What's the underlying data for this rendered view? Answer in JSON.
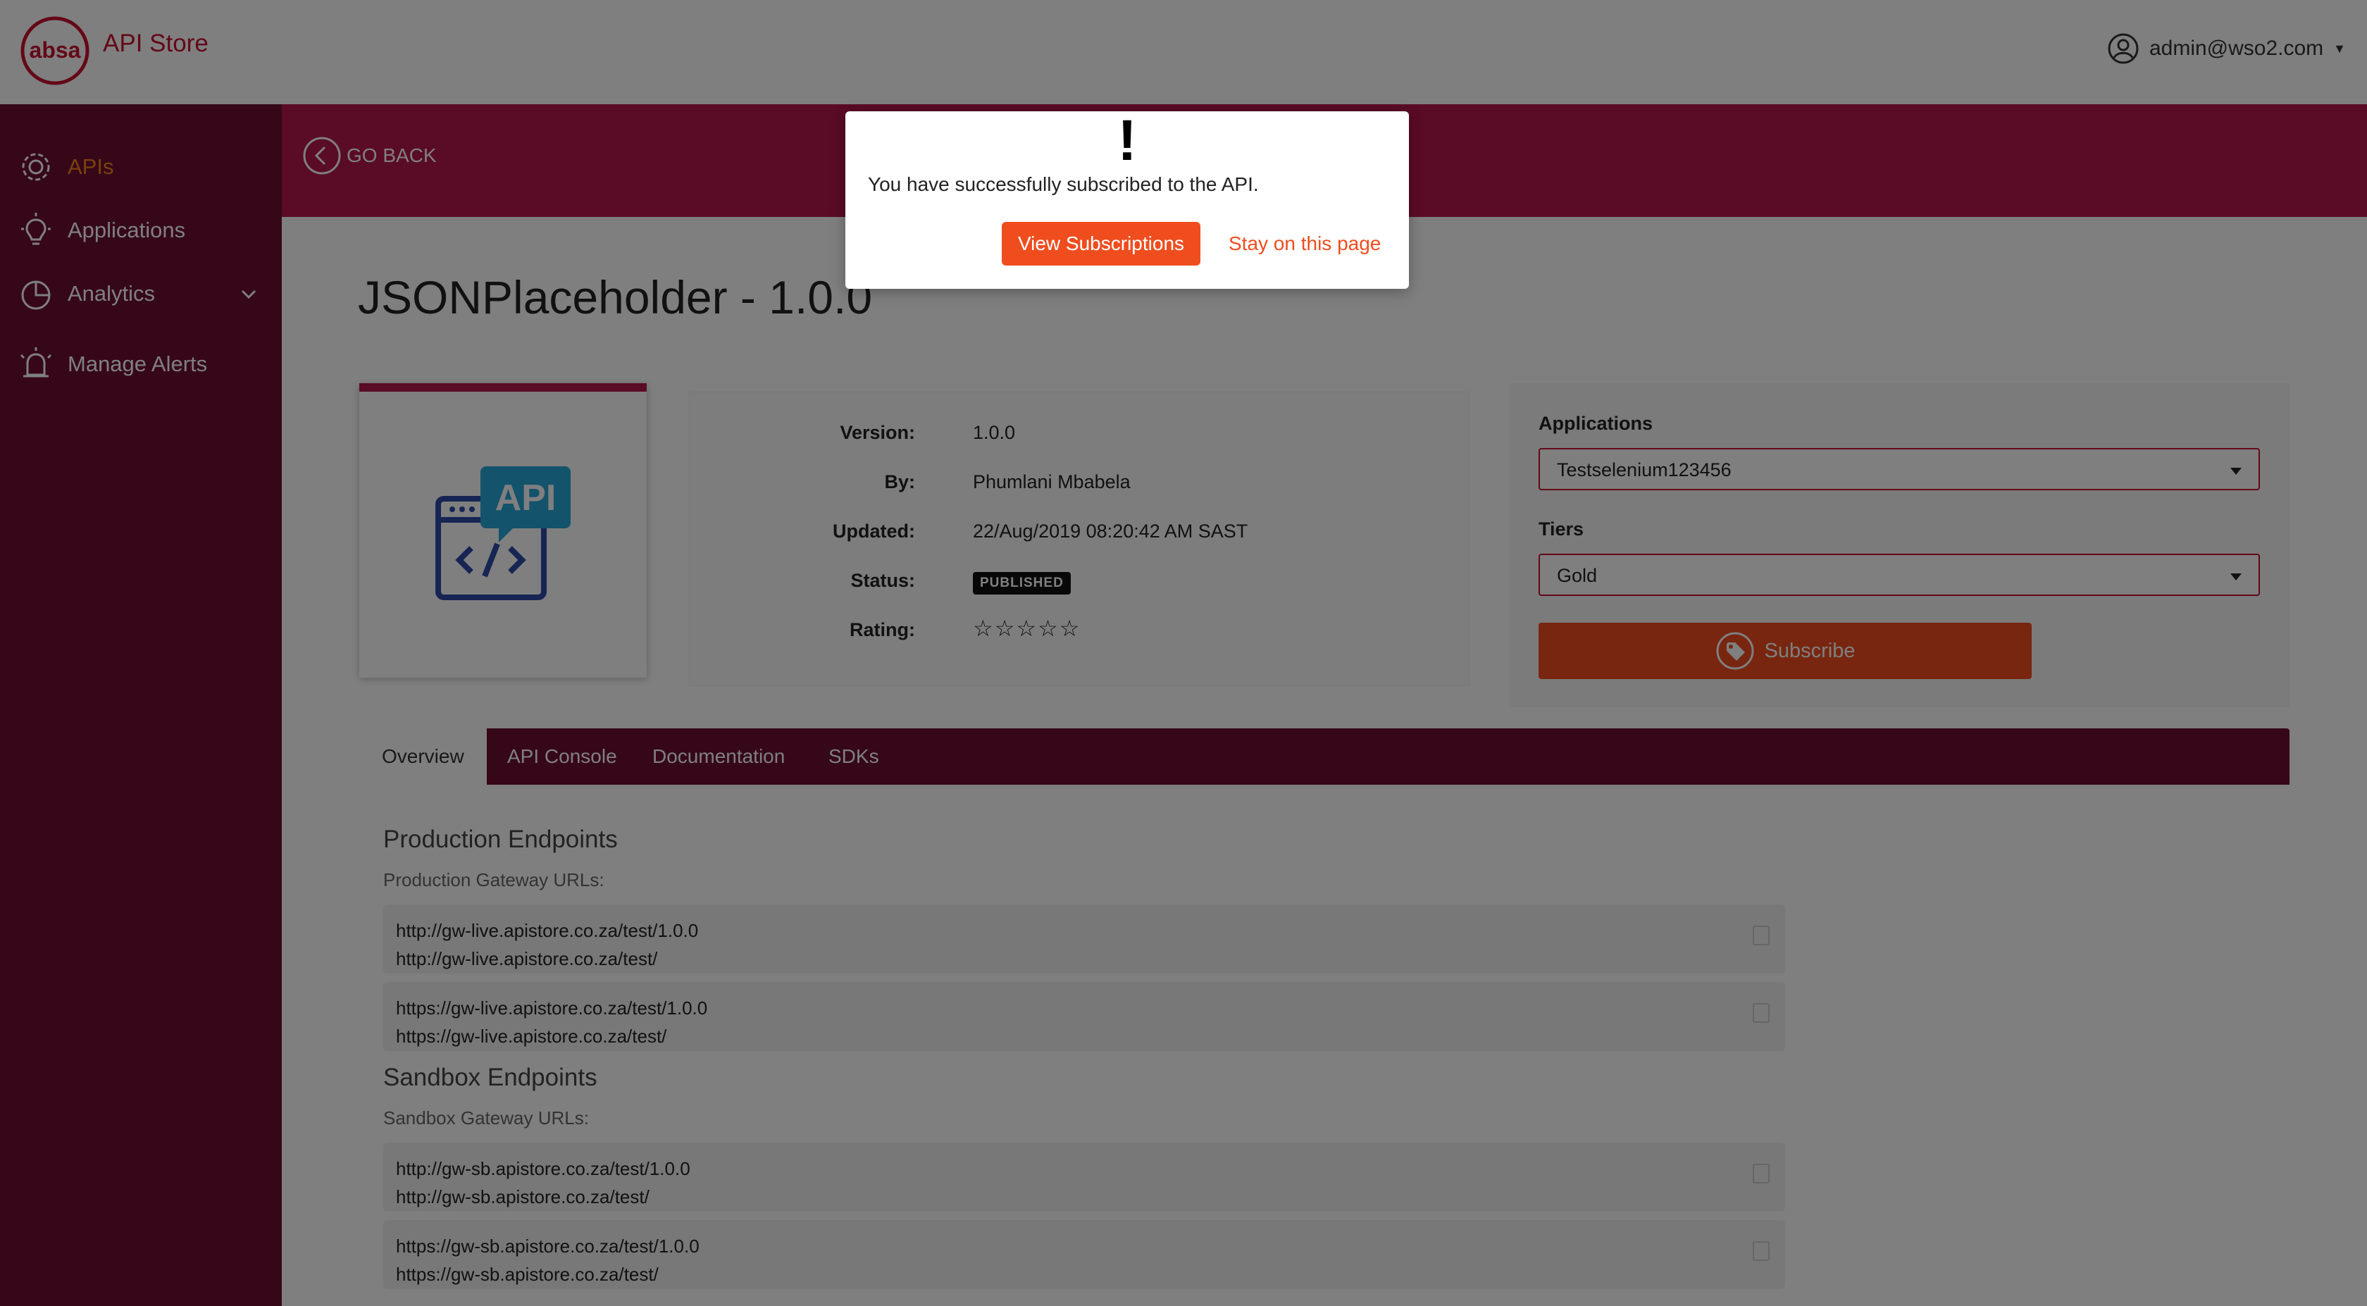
{
  "header": {
    "app_name": "API Store",
    "user": "admin@wso2.com"
  },
  "sidebar": {
    "items": [
      {
        "label": "APIs",
        "icon": "gear-icon",
        "active": true
      },
      {
        "label": "Applications",
        "icon": "lightbulb-icon"
      },
      {
        "label": "Analytics",
        "icon": "pie-chart-icon"
      },
      {
        "label": "Manage Alerts",
        "icon": "alarm-icon"
      }
    ]
  },
  "banner": {
    "go_back": "GO BACK"
  },
  "api": {
    "title": "JSONPlaceholder - 1.0.0",
    "thumbnail_text": "API",
    "info": {
      "version_label": "Version:",
      "version": "1.0.0",
      "by_label": "By:",
      "by": "Phumlani Mbabela",
      "updated_label": "Updated:",
      "updated": "22/Aug/2019 08:20:42 AM SAST",
      "status_label": "Status:",
      "status": "PUBLISHED",
      "rating_label": "Rating:",
      "rating": "☆☆☆☆☆"
    }
  },
  "subscribe": {
    "applications_label": "Applications",
    "application_value": "Testselenium123456",
    "tiers_label": "Tiers",
    "tier_value": "Gold",
    "button": "Subscribe"
  },
  "tabs": [
    "Overview",
    "API Console",
    "Documentation",
    "SDKs"
  ],
  "overview": {
    "production_title": "Production Endpoints",
    "production_sub": "Production Gateway URLs:",
    "production_urls": [
      [
        "http://gw-live.apistore.co.za/test/1.0.0",
        "http://gw-live.apistore.co.za/test/"
      ],
      [
        "https://gw-live.apistore.co.za/test/1.0.0",
        "https://gw-live.apistore.co.za/test/"
      ]
    ],
    "sandbox_title": "Sandbox Endpoints",
    "sandbox_sub": "Sandbox Gateway URLs:",
    "sandbox_urls": [
      [
        "http://gw-sb.apistore.co.za/test/1.0.0",
        "http://gw-sb.apistore.co.za/test/"
      ],
      [
        "https://gw-sb.apistore.co.za/test/1.0.0",
        "https://gw-sb.apistore.co.za/test/"
      ]
    ]
  },
  "dialog": {
    "icon": "!",
    "message": "You have successfully subscribed to the API.",
    "primary_button": "View Subscriptions",
    "secondary_link": "Stay on this page"
  },
  "colors": {
    "brand_red": "#c8102e",
    "sidebar": "#6d0f33",
    "banner": "#b5174a",
    "accent_orange": "#f04d1f"
  }
}
